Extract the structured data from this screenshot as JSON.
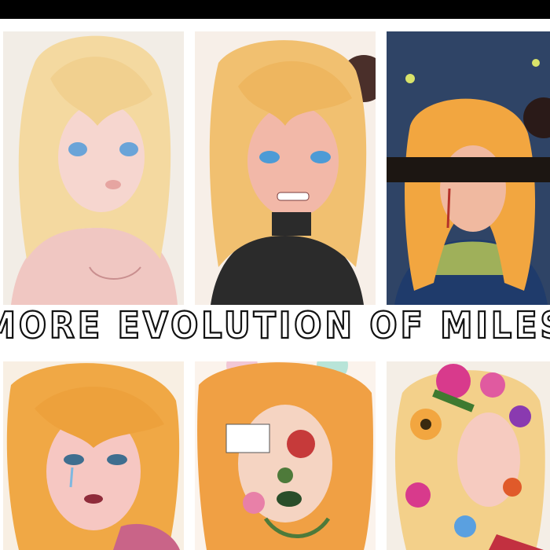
{
  "caption": "More evolution of miles",
  "panels": [
    {
      "label": "drawing-1"
    },
    {
      "label": "drawing-2"
    },
    {
      "label": "drawing-3"
    },
    {
      "label": "drawing-4"
    },
    {
      "label": "drawing-5"
    },
    {
      "label": "drawing-6"
    }
  ]
}
